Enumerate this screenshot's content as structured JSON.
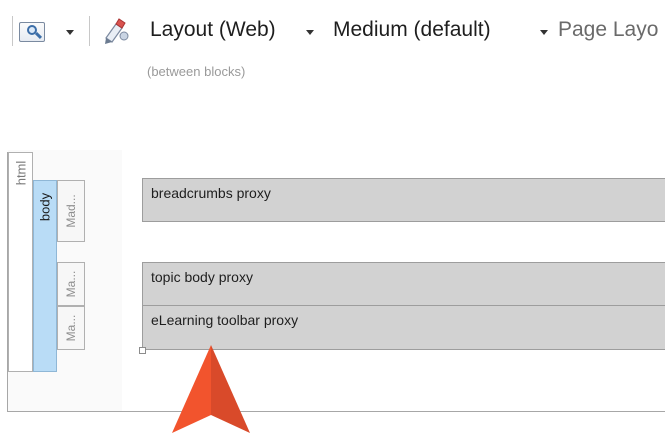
{
  "toolbar": {
    "view_dropdown_icon": "magnifier-page-icon",
    "style_icon": "pen-ribbon-icon",
    "layout_medium": "Layout (Web)",
    "medium": "Medium (default)",
    "page_layout": "Page Layo"
  },
  "canvas": {
    "hint": "(between blocks)",
    "tabs": {
      "html": "html",
      "body": "body",
      "mad": "Mad...",
      "ma1": "Ma...",
      "ma2": "Ma..."
    },
    "proxies": [
      "breadcrumbs proxy",
      "topic body proxy",
      "eLearning toolbar proxy"
    ]
  },
  "colors": {
    "body_tab": "#b9dcf6",
    "proxy_fill": "#d2d2d2",
    "pointer": "#f2542d"
  },
  "pointer_icon": "orange-arrow-pointer-icon"
}
